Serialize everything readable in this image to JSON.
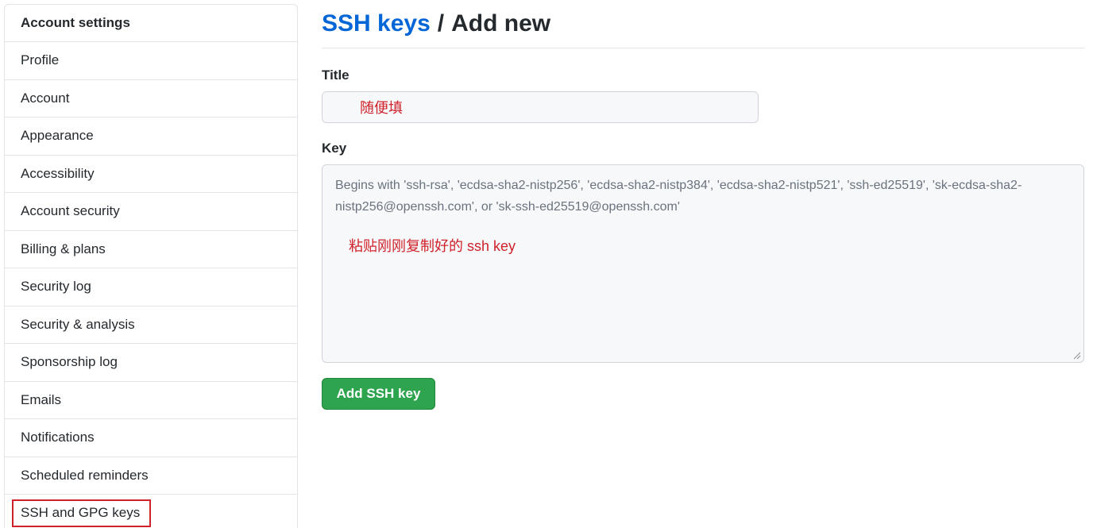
{
  "sidebar": {
    "header": "Account settings",
    "items": [
      {
        "label": "Profile"
      },
      {
        "label": "Account"
      },
      {
        "label": "Appearance"
      },
      {
        "label": "Accessibility"
      },
      {
        "label": "Account security"
      },
      {
        "label": "Billing & plans"
      },
      {
        "label": "Security log"
      },
      {
        "label": "Security & analysis"
      },
      {
        "label": "Sponsorship log"
      },
      {
        "label": "Emails"
      },
      {
        "label": "Notifications"
      },
      {
        "label": "Scheduled reminders"
      },
      {
        "label": "SSH and GPG keys",
        "highlighted": true
      }
    ]
  },
  "breadcrumb": {
    "link": "SSH keys",
    "separator": "/",
    "current": "Add new"
  },
  "form": {
    "title_label": "Title",
    "title_value": "随便填",
    "key_label": "Key",
    "key_placeholder": "Begins with 'ssh-rsa', 'ecdsa-sha2-nistp256', 'ecdsa-sha2-nistp384', 'ecdsa-sha2-nistp521', 'ssh-ed25519', 'sk-ecdsa-sha2-nistp256@openssh.com', or 'sk-ssh-ed25519@openssh.com'",
    "key_value": "粘贴刚刚复制好的 ssh key",
    "submit_label": "Add SSH key"
  },
  "colors": {
    "link": "#0366d6",
    "annotation_red": "#d0212a",
    "button_green": "#2ea44f"
  }
}
